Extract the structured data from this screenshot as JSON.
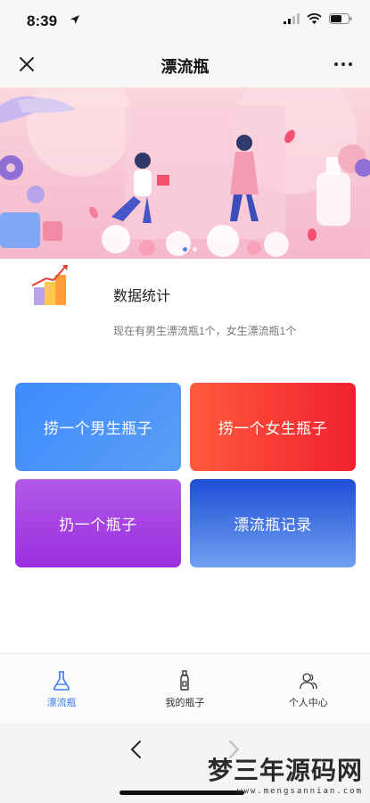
{
  "status_bar": {
    "time": "8:39",
    "icons": [
      "location-arrow-icon",
      "signal-icon",
      "wifi-icon",
      "battery-icon"
    ]
  },
  "header": {
    "title": "漂流瓶",
    "close_icon": "close-icon",
    "more_icon": "more-icon"
  },
  "banner": {
    "slides": 3,
    "active_slide": 1,
    "colors": {
      "background": "#f7c4d3",
      "active_dot": "#5b7cf0"
    }
  },
  "stats": {
    "title": "数据统计",
    "description": "现在有男生漂流瓶1个，女生漂流瓶1个",
    "icon": "bar-chart-icon"
  },
  "actions": [
    {
      "label": "捞一个男生瓶子",
      "color": "#3d8bff"
    },
    {
      "label": "捞一个女生瓶子",
      "color": "#f0202f"
    },
    {
      "label": "扔一个瓶子",
      "color": "#9a2ee0"
    },
    {
      "label": "漂流瓶记录",
      "color": "#1f4fd6"
    }
  ],
  "tabbar": {
    "items": [
      {
        "label": "漂流瓶",
        "icon": "flask-icon",
        "active": true
      },
      {
        "label": "我的瓶子",
        "icon": "bottle-icon",
        "active": false
      },
      {
        "label": "个人中心",
        "icon": "user-icon",
        "active": false
      }
    ],
    "active_color": "#3a7df0"
  },
  "browser": {
    "back_icon": "back-arrow-icon",
    "forward_icon": "forward-arrow-icon"
  },
  "watermark": {
    "text": "梦三年源码网",
    "url": "www.mengsannian.com"
  }
}
